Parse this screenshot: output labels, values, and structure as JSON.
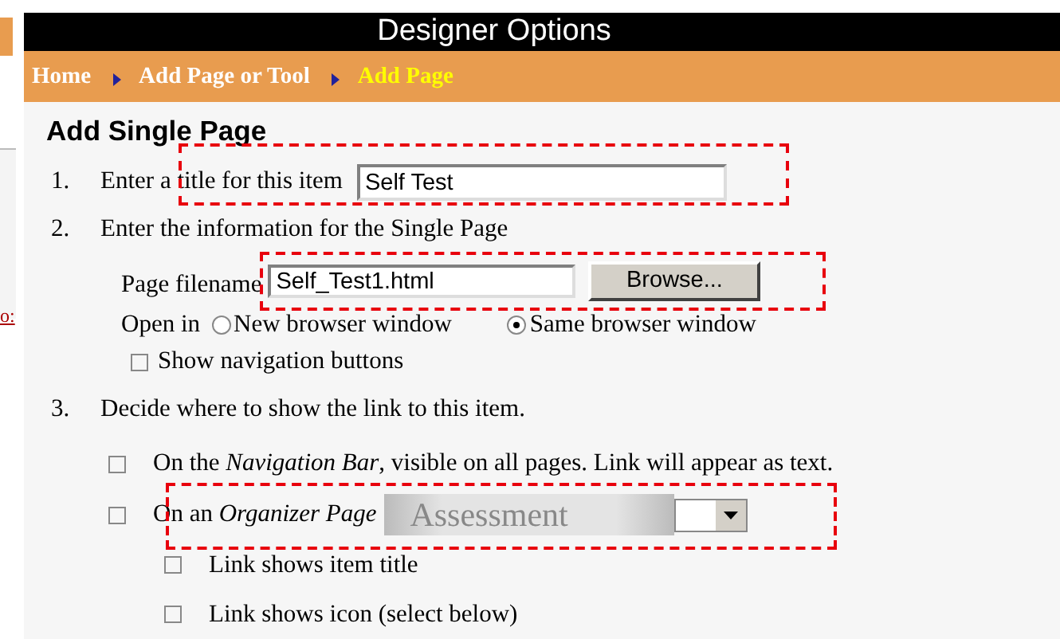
{
  "background_window": {
    "link_fragment": "o:"
  },
  "window": {
    "title": "Designer Options"
  },
  "breadcrumb": [
    {
      "label": "Home",
      "current": false
    },
    {
      "label": "Add Page or Tool",
      "current": false
    },
    {
      "label": "Add Page",
      "current": true
    }
  ],
  "heading": "Add Single Page",
  "step1": {
    "number": "1.",
    "label": "Enter a title for this item",
    "title_field": {
      "value": "Self Test"
    }
  },
  "step2": {
    "number": "2.",
    "label": "Enter the information for the Single Page",
    "filename_label": "Page filename",
    "filename_field": {
      "value": "Self_Test1.html"
    },
    "browse_button": "Browse...",
    "open_in_label": "Open in",
    "open_options": [
      {
        "label": "New browser window",
        "selected": false
      },
      {
        "label": "Same browser window",
        "selected": true
      }
    ],
    "show_nav": {
      "label": "Show navigation buttons",
      "checked": false
    }
  },
  "step3": {
    "number": "3.",
    "label": "Decide where to show the link to this item.",
    "options": [
      {
        "label": "On the *Navigation Bar*, visible on all pages. Link will appear as text.",
        "checked": false
      },
      {
        "label": "On an *Organizer Page*",
        "checked": false,
        "dropdown": {
          "value": "Assessment"
        }
      }
    ],
    "sub_options": [
      {
        "label": "Link shows item title",
        "checked": false
      },
      {
        "label": "Link shows icon (select below)",
        "checked": false
      }
    ]
  }
}
